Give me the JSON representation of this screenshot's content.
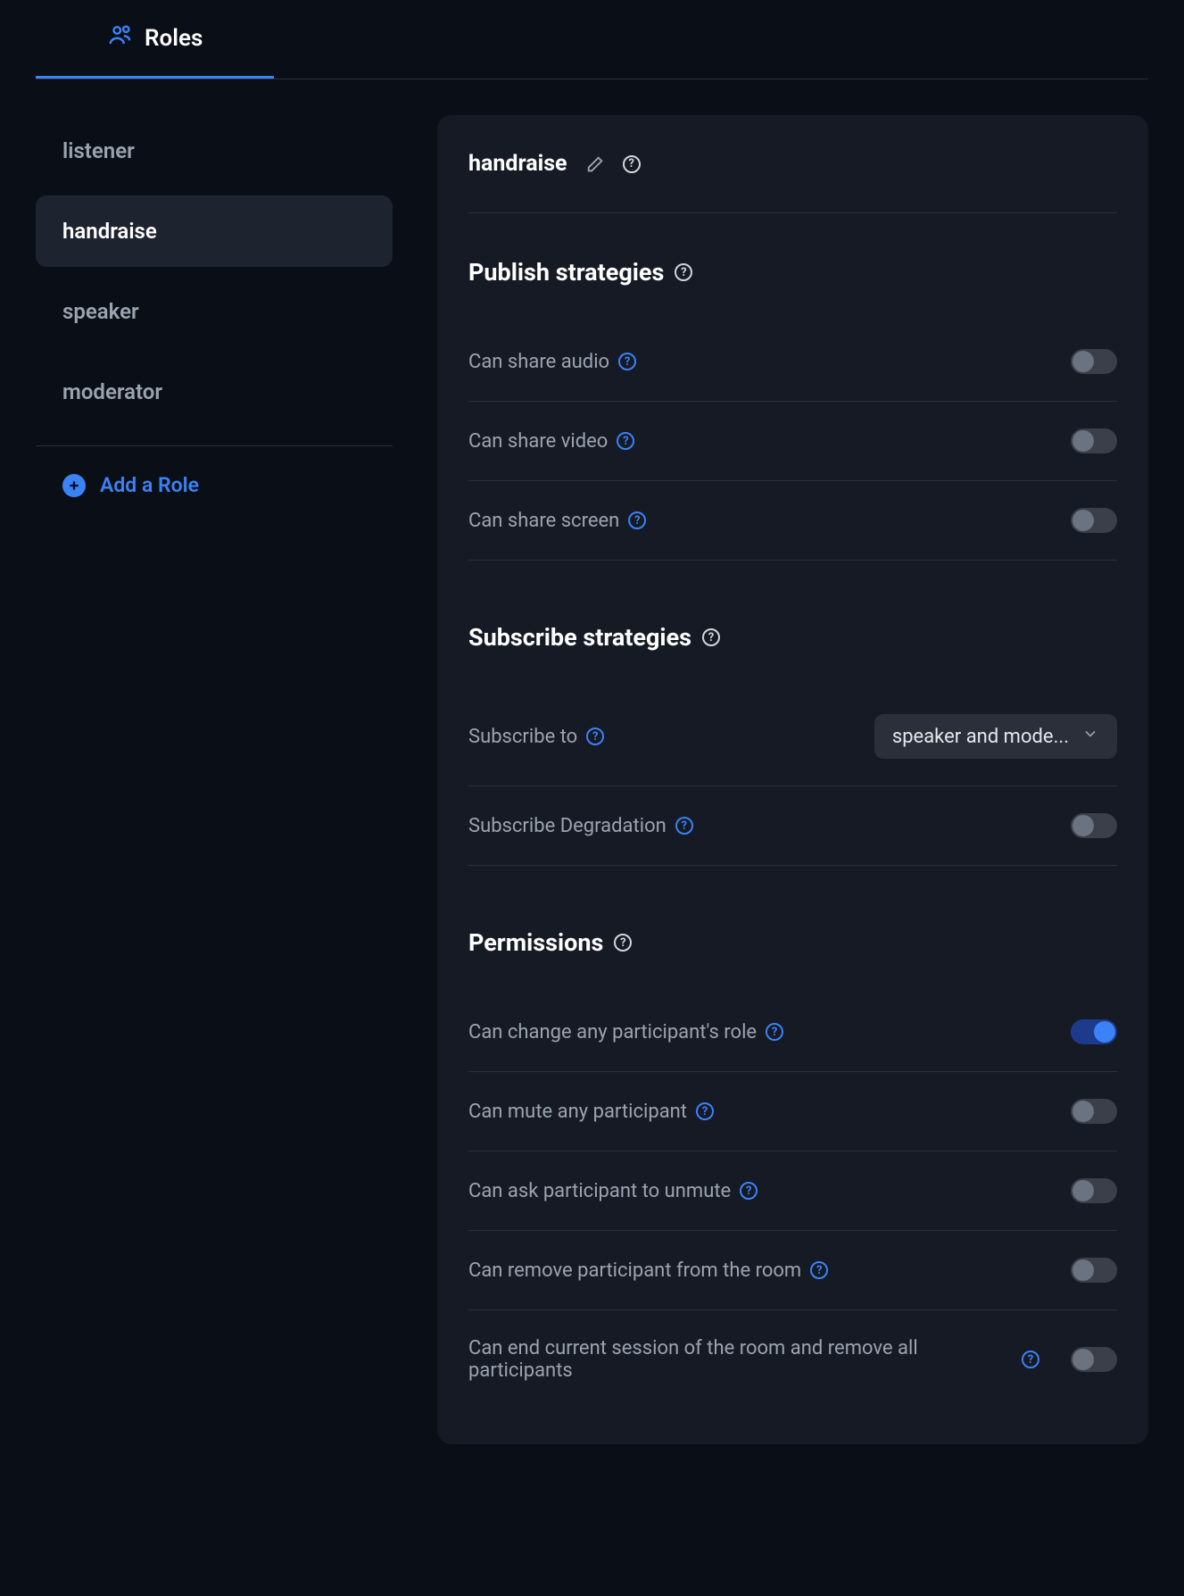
{
  "tab": {
    "label": "Roles"
  },
  "sidebar": {
    "roles": [
      {
        "label": "listener",
        "active": false
      },
      {
        "label": "handraise",
        "active": true
      },
      {
        "label": "speaker",
        "active": false
      },
      {
        "label": "moderator",
        "active": false
      }
    ],
    "add_label": "Add a Role"
  },
  "role": {
    "name": "handraise"
  },
  "sections": {
    "publish": {
      "title": "Publish strategies",
      "rows": [
        {
          "label": "Can share audio",
          "value": false
        },
        {
          "label": "Can share video",
          "value": false
        },
        {
          "label": "Can share screen",
          "value": false
        }
      ]
    },
    "subscribe": {
      "title": "Subscribe strategies",
      "subscribe_to_label": "Subscribe to",
      "subscribe_to_value": "speaker and mode...",
      "degradation_label": "Subscribe Degradation",
      "degradation_value": false
    },
    "permissions": {
      "title": "Permissions",
      "rows": [
        {
          "label": "Can change any participant's role",
          "value": true
        },
        {
          "label": "Can mute any participant",
          "value": false
        },
        {
          "label": "Can ask participant to unmute",
          "value": false
        },
        {
          "label": "Can remove participant from the room",
          "value": false
        },
        {
          "label": "Can end current session of the room and remove all participants",
          "value": false
        }
      ]
    }
  }
}
